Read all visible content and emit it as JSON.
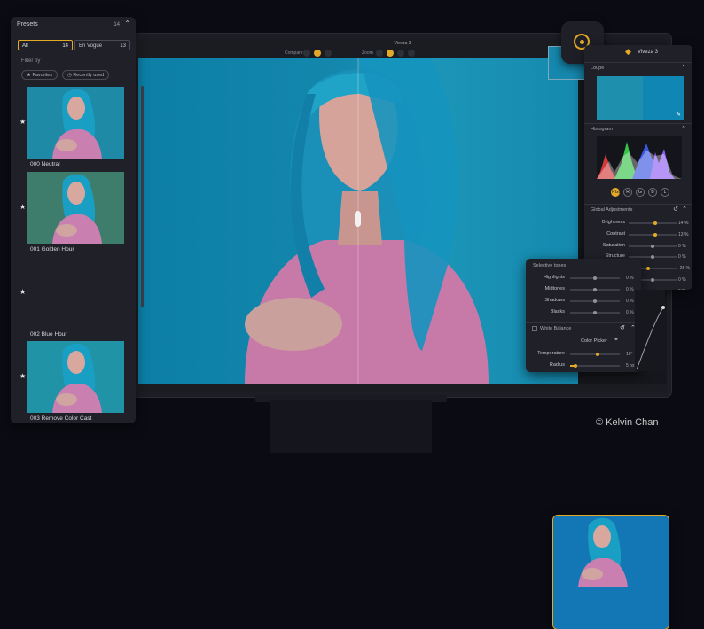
{
  "app": {
    "title": "Viveza 3",
    "toolbar": {
      "compare_label": "Compare",
      "zoom_label": "Zoom"
    }
  },
  "presets": {
    "title": "Presets",
    "count": "14",
    "tabs": [
      {
        "label": "All",
        "count": "14",
        "active": true
      },
      {
        "label": "En Vogue",
        "count": "13",
        "active": false
      }
    ],
    "filter_by": "Filter by",
    "chips": [
      "Favorites",
      "Recently used"
    ],
    "items": [
      {
        "label": "000 Neutral",
        "tint": "#1e8aa6",
        "selected": false
      },
      {
        "label": "001 Golden Hour",
        "tint": "#3e7d6c",
        "selected": false
      },
      {
        "label": "002 Blue Hour",
        "tint": "#1277b4",
        "selected": true
      },
      {
        "label": "003 Remove Color Cast",
        "tint": "#2093a6",
        "selected": false
      }
    ]
  },
  "right_panel": {
    "header": "Viveza 3",
    "loupe": "Loupe",
    "histogram": "Histogram",
    "channels": [
      "RGB",
      "R",
      "G",
      "B",
      "L"
    ],
    "global_adjustments": "Global Adjustments",
    "adjustments": [
      {
        "label": "Brightness",
        "value": "14 %",
        "pos": 0.55,
        "gold": true
      },
      {
        "label": "Contrast",
        "value": "13 %",
        "pos": 0.55,
        "gold": true
      },
      {
        "label": "Saturation",
        "value": "0 %",
        "pos": 0.5,
        "gold": false
      },
      {
        "label": "Structure",
        "value": "0 %",
        "pos": 0.5,
        "gold": false
      },
      {
        "label": "",
        "value": "-25 %",
        "pos": 0.4,
        "gold": true
      },
      {
        "label": "",
        "value": "0 %",
        "pos": 0.5,
        "gold": false
      },
      {
        "label": "",
        "value": "0 %",
        "pos": 0.5,
        "gold": false
      }
    ]
  },
  "selective_tones": {
    "title": "Selective tones",
    "tones": [
      {
        "label": "Highlights",
        "value": "0 %",
        "pos": 0.5,
        "gold": false
      },
      {
        "label": "Midtones",
        "value": "0 %",
        "pos": 0.5,
        "gold": false
      },
      {
        "label": "Shadows",
        "value": "0 %",
        "pos": 0.5,
        "gold": false
      },
      {
        "label": "Blacks",
        "value": "0 %",
        "pos": 0.5,
        "gold": false
      }
    ],
    "white_balance": "White Balance",
    "color_picker": "Color Picker",
    "temperature": {
      "label": "Temperature",
      "value": "16°",
      "pos": 0.55
    },
    "radius": {
      "label": "Radius",
      "value": "5 px",
      "pos": 0.1
    }
  },
  "copyright": "© Kelvin Chan",
  "colors": {
    "accent": "#e5a928",
    "panel": "#202128",
    "background": "#0b0c13"
  }
}
